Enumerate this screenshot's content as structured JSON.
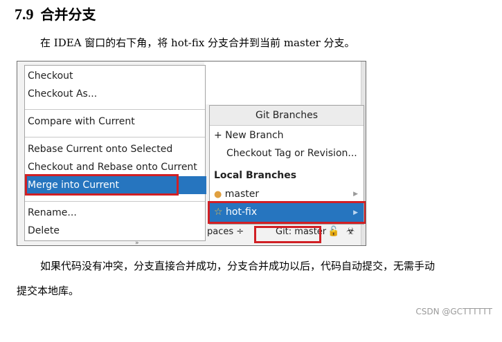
{
  "doc": {
    "section_number": "7.9",
    "section_title": "合并分支",
    "intro": "在 IDEA 窗口的右下角，将 hot-fix 分支合并到当前 master 分支。",
    "result_line1": "如果代码没有冲突，分支直接合并成功，分支合并成功以后，代码自动提交，无需手动",
    "result_line2": "提交本地库。",
    "watermark": "CSDN @GCTTTTTT"
  },
  "context_menu": {
    "items": [
      "Checkout",
      "Checkout As...",
      "Compare with Current",
      "Rebase Current onto Selected",
      "Checkout and Rebase onto Current",
      "Merge into Current",
      "Rename...",
      "Delete"
    ],
    "selected": "Merge into Current"
  },
  "git_branches": {
    "title": "Git Branches",
    "new_branch": "+ New Branch",
    "checkout_tag": "Checkout Tag or Revision...",
    "local_branches_header": "Local Branches",
    "branches": [
      "master",
      "hot-fix"
    ],
    "selected_branch": "hot-fix"
  },
  "status_bar": {
    "workspaces": "paces ÷",
    "git_label": "Git: master ÷",
    "lock_icon": "lock-icon",
    "bot_icon": "bot-icon"
  },
  "colors": {
    "selection": "#2675bf",
    "highlight_box": "#d11f24"
  },
  "icons": {
    "tag": "tag-icon",
    "star": "star-icon",
    "submenu": "chevron-right-icon"
  }
}
